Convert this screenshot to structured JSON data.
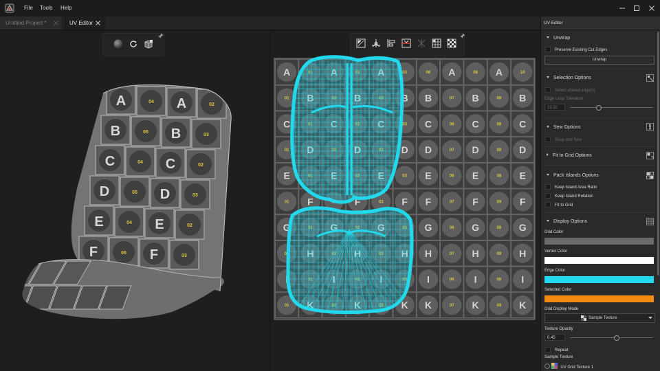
{
  "menu": {
    "file": "File",
    "tools": "Tools",
    "help": "Help"
  },
  "tabs": [
    {
      "label": "Untitled Project *"
    },
    {
      "label": "UV Editor"
    }
  ],
  "panel": {
    "title": "UV Editor",
    "unwrap": {
      "header": "Unwrap",
      "preserve_cut_edges": "Preserve Existing Cut Edges",
      "button": "Unwrap"
    },
    "selection": {
      "header": "Selection Options",
      "select_shared_edges": "Select shared edge(s)",
      "edge_loop_tolerance_label": "Edge Loop Tolerance",
      "edge_loop_tolerance_value": "23.32",
      "edge_loop_tolerance_fraction": 0.35
    },
    "sew": {
      "header": "Sew Options",
      "snap_and_sew": "Snap and Sew"
    },
    "fit": {
      "header": "Fit to Grid Options"
    },
    "pack": {
      "header": "Pack Islands Options",
      "keep_area_ratio": "Keep Island Area Ratio",
      "keep_rotation": "Keep Island Rotation",
      "fit_to_grid": "Fit to Grid"
    },
    "display": {
      "header": "Display Options",
      "grid_color_label": "Grid Color",
      "vertex_color_label": "Vertex Color",
      "edge_color_label": "Edge Color",
      "selected_color_label": "Selected Color",
      "grid_display_mode_label": "Grid Display Mode",
      "grid_display_mode_value": "Sample Texture",
      "texture_opacity_label": "Texture Opacity",
      "texture_opacity_value": "0.45",
      "repeat_label": "Repeat",
      "sample_texture_label": "Sample Texture",
      "sample_texture_option": "UV Grid Texture 1"
    }
  },
  "colors": {
    "grid": "#6b6b6b",
    "vertex": "#ffffff",
    "edge": "#22d8ec",
    "selected": "#f08a10",
    "accent": "#22d8ec"
  },
  "uv_grid": {
    "rows": [
      [
        "A",
        "01",
        "A",
        "02",
        "A",
        "03",
        "06",
        "A",
        "08",
        "A",
        "10"
      ],
      [
        "01",
        "B",
        "02",
        "B",
        "03",
        "B",
        "B",
        "07",
        "B",
        "09",
        "B"
      ],
      [
        "C",
        "01",
        "C",
        "02",
        "C",
        "03",
        "C",
        "06",
        "C",
        "08",
        "C"
      ],
      [
        "01",
        "D",
        "02",
        "D",
        "03",
        "D",
        "D",
        "07",
        "D",
        "09",
        "D"
      ],
      [
        "E",
        "01",
        "E",
        "02",
        "E",
        "03",
        "E",
        "06",
        "E",
        "08",
        "E"
      ],
      [
        "01",
        "F",
        "02",
        "F",
        "03",
        "F",
        "F",
        "07",
        "F",
        "09",
        "F"
      ],
      [
        "G",
        "01",
        "G",
        "02",
        "G",
        "03",
        "G",
        "06",
        "G",
        "08",
        "G"
      ],
      [
        "01",
        "H",
        "02",
        "H",
        "03",
        "H",
        "H",
        "07",
        "H",
        "09",
        "H"
      ],
      [
        "I",
        "01",
        "I",
        "02",
        "I",
        "03",
        "I",
        "06",
        "I",
        "08",
        "I"
      ],
      [
        "01",
        "K",
        "02",
        "K",
        "03",
        "K",
        "K",
        "07",
        "K",
        "09",
        "K"
      ]
    ]
  },
  "seat_grid": {
    "rows": [
      [
        "A",
        "04",
        "A",
        "02"
      ],
      [
        "B",
        "05",
        "B",
        "03"
      ],
      [
        "C",
        "04",
        "C",
        "02"
      ],
      [
        "D",
        "05",
        "D",
        "03"
      ],
      [
        "E",
        "04",
        "E",
        "02"
      ],
      [
        "F",
        "05",
        "F",
        "03"
      ]
    ]
  },
  "icons": {
    "toolbar3d": [
      "sphere-icon",
      "reset-rotation-icon",
      "cube-icon"
    ],
    "uv_toolbar": [
      "unwrap-icon",
      "pinch-icon",
      "align-icon",
      "cut-icon",
      "sew-icon",
      "grid-fit-icon",
      "checker-icon"
    ]
  }
}
